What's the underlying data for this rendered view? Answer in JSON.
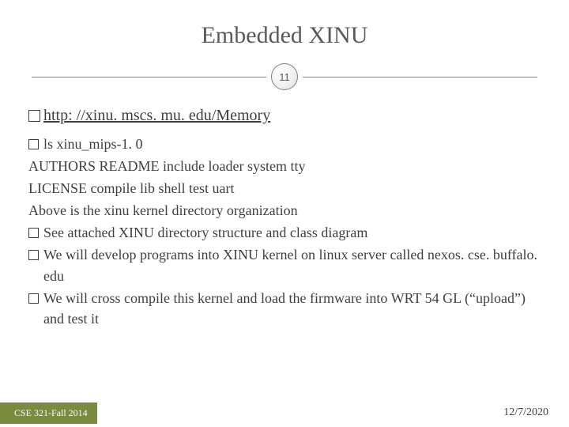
{
  "title": "Embedded XINU",
  "page_number": "11",
  "link": {
    "url_text": "http: //xinu. mscs. mu. edu/Memory"
  },
  "body": {
    "b1": "ls xinu_mips-1. 0",
    "l2": "AUTHORS README  include loader  system  tty",
    "l3": "LICENSE compile lib     shell   test    uart",
    "l4": "Above is the xinu kernel directory organization",
    "b5": "See attached XINU directory structure and class diagram",
    "b6": "We will develop programs into XINU kernel on linux server called nexos. cse. buffalo. edu",
    "b7": "We will cross compile this kernel and load the firmware into WRT 54 GL (“upload”) and test it"
  },
  "footer": {
    "left": "CSE 321-Fall 2014",
    "right": "12/7/2020"
  }
}
